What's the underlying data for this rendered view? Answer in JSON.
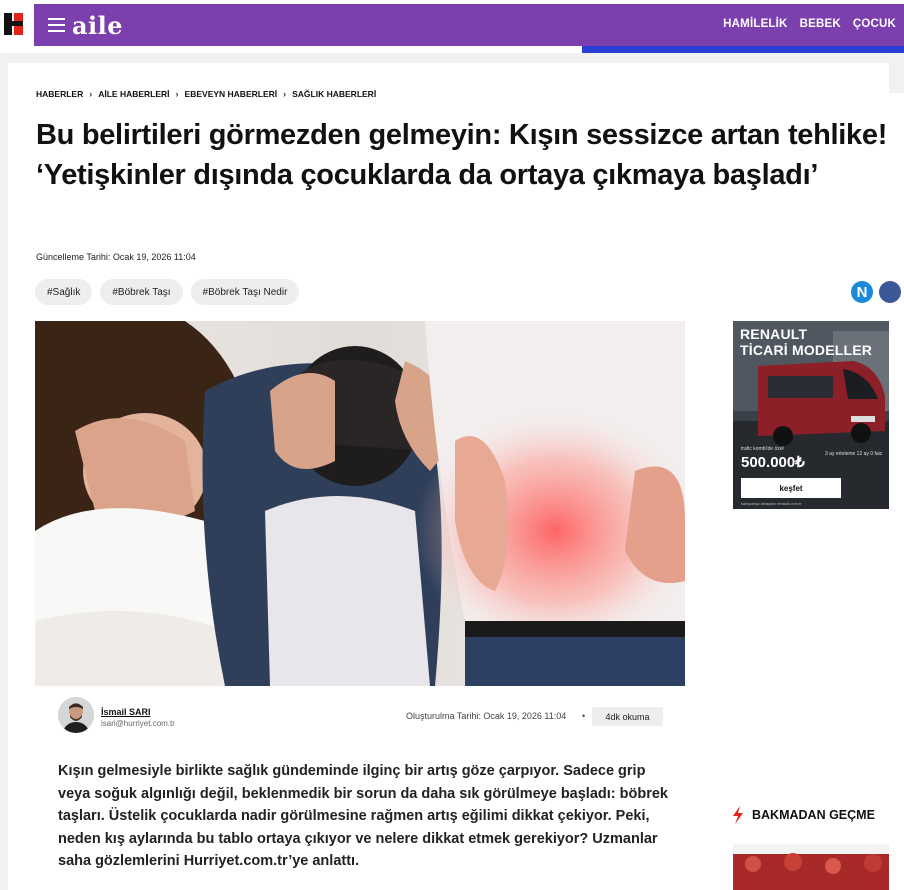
{
  "header": {
    "brand": "aile",
    "nav": [
      "HAMİLELİK",
      "BEBEK",
      "ÇOCUK"
    ]
  },
  "breadcrumb": [
    "HABERLER",
    "AİLE HABERLERİ",
    "EBEVEYN HABERLERİ",
    "SAĞLIK HABERLERİ"
  ],
  "article": {
    "headline": "Bu belirtileri görmezden gelmeyin: Kışın sessizce artan tehlike! ‘Yetişkinler dışında çocuklarda da ortaya çıkmaya başladı’",
    "updated": "Güncelleme Tarihi: Ocak 19, 2026 11:04",
    "tags": [
      "#Sağlık",
      "#Böbrek Taşı",
      "#Böbrek Taşı Nedir"
    ],
    "author_name": "İsmail SARI",
    "author_email": "isari@hurriyet.com.tr",
    "created": "Oluşturulma Tarihi: Ocak 19, 2026 11:04",
    "dot": "•",
    "read_time": "4dk okuma",
    "lead": "Kışın gelmesiyle birlikte sağlık gündeminde ilginç bir artış göze çarpıyor. Sadece grip veya soğuk algınlığı değil, beklenmedik bir sorun da daha sık görülmeye başladı: böbrek taşları. Üstelik çocuklarda nadir görülmesine rağmen artış eğilimi dikkat çekiyor. Peki, neden kış aylarında bu tablo ortaya çıkıyor ve nelere dikkat etmek gerekiyor? Uzmanlar saha gözlemlerini Hurriyet.com.tr’ye anlattı."
  },
  "share": {
    "n_label": "N"
  },
  "ad": {
    "title_line1": "RENAULT",
    "title_line2": "TİCARİ MODELLER",
    "small_left": "trafic kombi'de özel",
    "price": "500.000₺",
    "small_right": "3 ay erteleme 12 ay 0 faiz",
    "button": "keşfet",
    "footer": "kampanya detayları renault.com.tr"
  },
  "sidebar": {
    "widget_title": "BAKMADAN GEÇME"
  },
  "colors": {
    "header_purple": "#7b3fae",
    "accent_blue": "#2a3fd6",
    "logo_red": "#e2231a",
    "bolt_red": "#e2231a"
  }
}
